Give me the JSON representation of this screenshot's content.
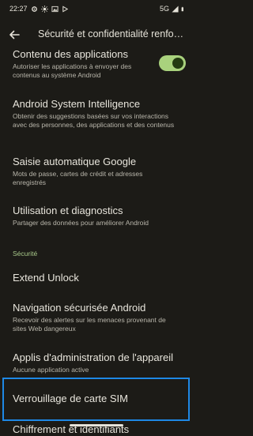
{
  "status": {
    "time": "22:27",
    "network": "5G"
  },
  "appbar": {
    "title": "Sécurité et confidentialité renfo…"
  },
  "items": [
    {
      "title": "Contenu des applications",
      "subtitle": "Autoriser les applications à envoyer des contenus au système Android",
      "toggle_on": true
    },
    {
      "title": "Android System Intelligence",
      "subtitle": "Obtenir des suggestions basées sur vos interactions avec des personnes, des applications et des contenus"
    },
    {
      "title": "Saisie automatique Google",
      "subtitle": "Mots de passe, cartes de crédit et adresses enregistrés"
    },
    {
      "title": "Utilisation et diagnostics",
      "subtitle": "Partager des données pour améliorer Android"
    }
  ],
  "security_section": {
    "header": "Sécurité",
    "items": [
      {
        "title": "Extend Unlock"
      },
      {
        "title": "Navigation sécurisée Android",
        "subtitle": "Recevoir des alertes sur les menaces provenant de sites Web dangereux"
      },
      {
        "title": "Applis d'administration de l'appareil",
        "subtitle": "Aucune application active"
      },
      {
        "title": "Verrouillage de carte SIM"
      },
      {
        "title": "Chiffrement et identifiants"
      }
    ]
  },
  "colors": {
    "background": "#1c1b17",
    "accent": "#a8c98a",
    "highlight": "#1e88e5"
  }
}
